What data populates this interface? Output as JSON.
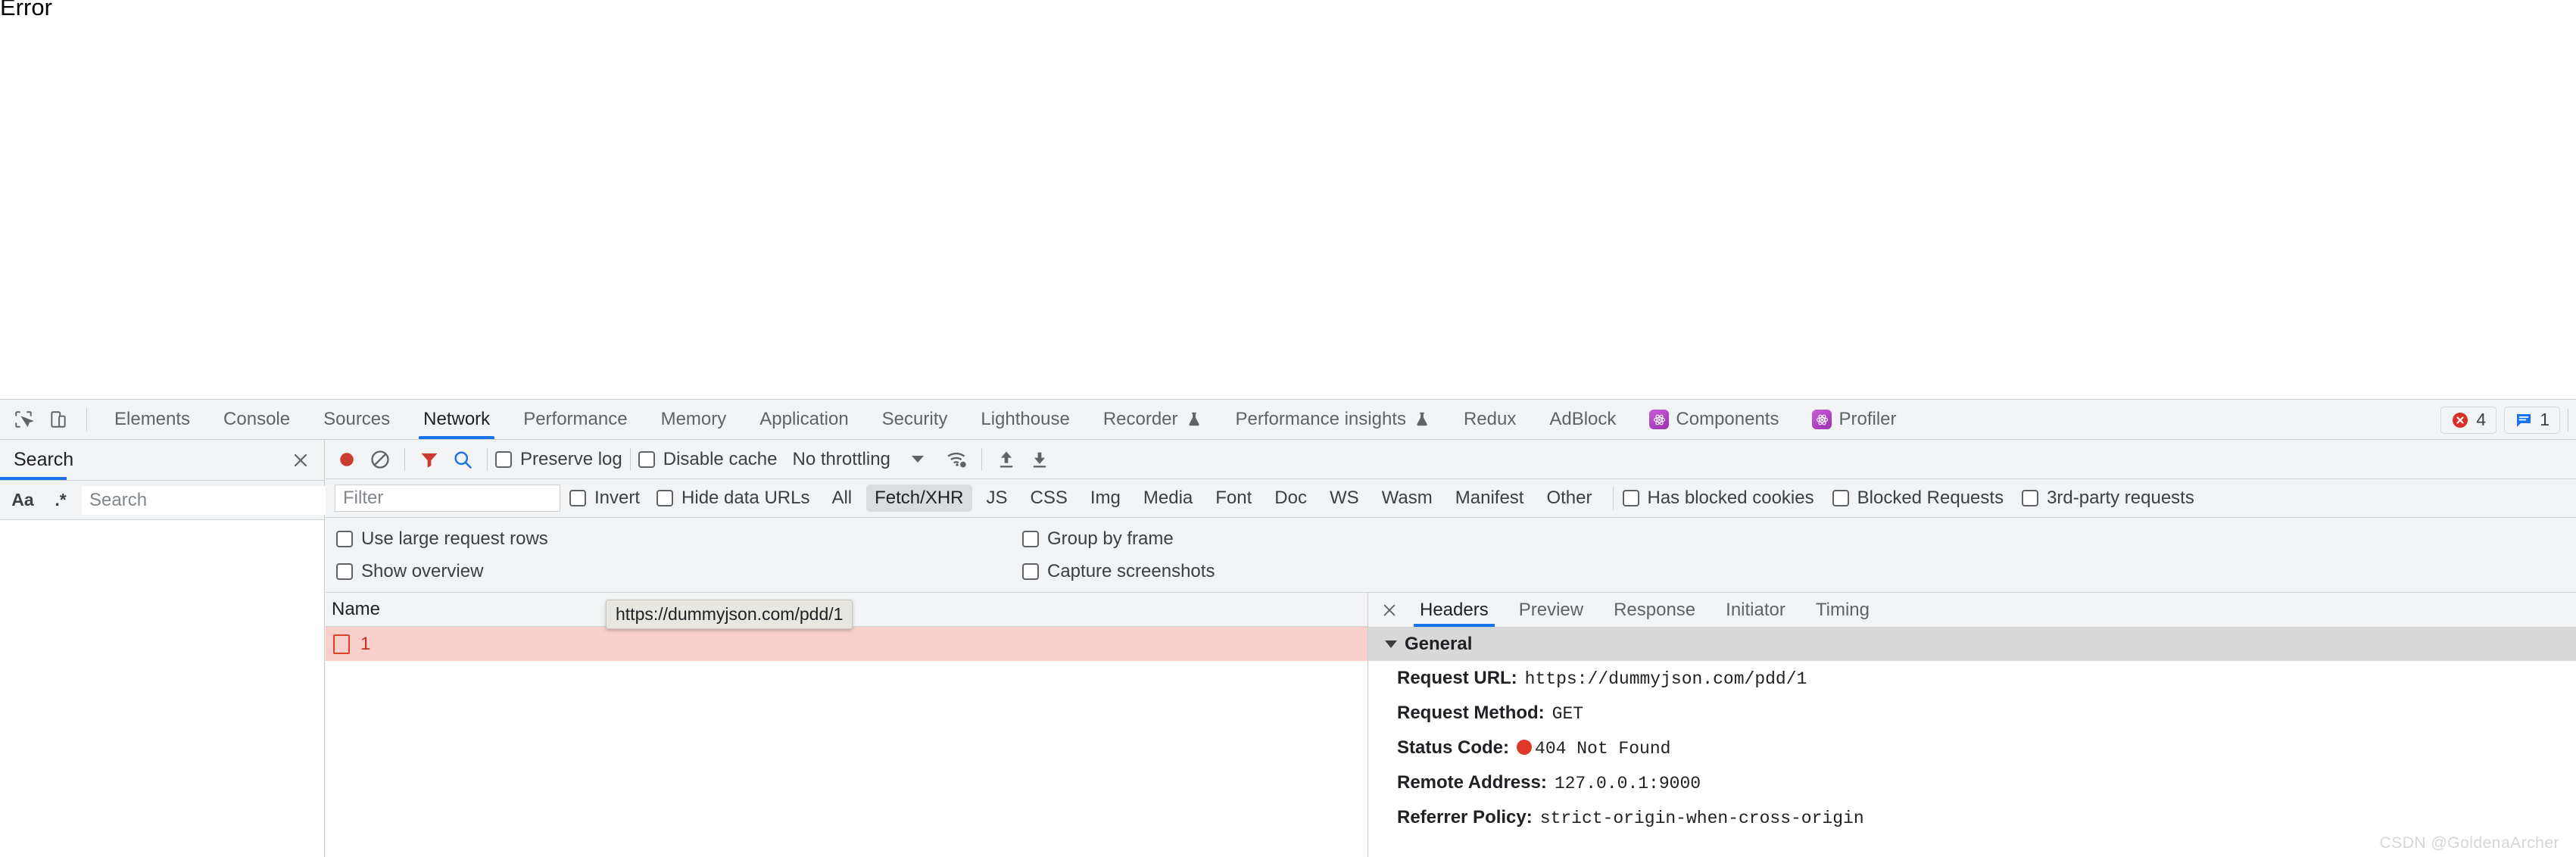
{
  "page": {
    "error_text": "Error"
  },
  "devtools": {
    "inspect_icon": "inspect-element-icon",
    "device_icon": "device-toolbar-icon",
    "tabs": [
      {
        "label": "Elements",
        "active": false,
        "flask": false,
        "ext": false
      },
      {
        "label": "Console",
        "active": false,
        "flask": false,
        "ext": false
      },
      {
        "label": "Sources",
        "active": false,
        "flask": false,
        "ext": false
      },
      {
        "label": "Network",
        "active": true,
        "flask": false,
        "ext": false
      },
      {
        "label": "Performance",
        "active": false,
        "flask": false,
        "ext": false
      },
      {
        "label": "Memory",
        "active": false,
        "flask": false,
        "ext": false
      },
      {
        "label": "Application",
        "active": false,
        "flask": false,
        "ext": false
      },
      {
        "label": "Security",
        "active": false,
        "flask": false,
        "ext": false
      },
      {
        "label": "Lighthouse",
        "active": false,
        "flask": false,
        "ext": false
      },
      {
        "label": "Recorder",
        "active": false,
        "flask": true,
        "ext": false
      },
      {
        "label": "Performance insights",
        "active": false,
        "flask": true,
        "ext": false
      },
      {
        "label": "Redux",
        "active": false,
        "flask": false,
        "ext": false
      },
      {
        "label": "AdBlock",
        "active": false,
        "flask": false,
        "ext": false
      },
      {
        "label": "Components",
        "active": false,
        "flask": false,
        "ext": true
      },
      {
        "label": "Profiler",
        "active": false,
        "flask": false,
        "ext": true
      }
    ],
    "error_count": "4",
    "message_count": "1",
    "error_icon": "error-circle-icon",
    "message_icon": "message-bubble-icon"
  },
  "search_drawer": {
    "title": "Search",
    "close_icon": "close-icon",
    "match_case_label": "Aa",
    "regex_label": ".*",
    "input_value": "",
    "input_placeholder": "Search",
    "refresh_icon": "refresh-icon",
    "clear_icon": "clear-icon"
  },
  "network": {
    "toolbar": {
      "record_icon": "record-button-icon",
      "clear_icon": "clear-icon",
      "filter_icon": "filter-icon",
      "search_icon": "search-icon",
      "preserve_log_label": "Preserve log",
      "preserve_log_checked": false,
      "disable_cache_label": "Disable cache",
      "disable_cache_checked": false,
      "throttling_value": "No throttling",
      "network_conditions_icon": "wifi-settings-icon",
      "import_icon": "import-har-icon",
      "export_icon": "export-har-icon"
    },
    "filterbar": {
      "filter_value": "",
      "filter_placeholder": "Filter",
      "invert_label": "Invert",
      "invert_checked": false,
      "hide_data_urls_label": "Hide data URLs",
      "hide_data_urls_checked": false,
      "types": [
        {
          "label": "All",
          "selected": false
        },
        {
          "label": "Fetch/XHR",
          "selected": true
        },
        {
          "label": "JS",
          "selected": false
        },
        {
          "label": "CSS",
          "selected": false
        },
        {
          "label": "Img",
          "selected": false
        },
        {
          "label": "Media",
          "selected": false
        },
        {
          "label": "Font",
          "selected": false
        },
        {
          "label": "Doc",
          "selected": false
        },
        {
          "label": "WS",
          "selected": false
        },
        {
          "label": "Wasm",
          "selected": false
        },
        {
          "label": "Manifest",
          "selected": false
        },
        {
          "label": "Other",
          "selected": false
        }
      ],
      "has_blocked_cookies_label": "Has blocked cookies",
      "has_blocked_cookies_checked": false,
      "blocked_requests_label": "Blocked Requests",
      "blocked_requests_checked": false,
      "third_party_label": "3rd-party requests",
      "third_party_checked": false
    },
    "settings": {
      "use_large_rows_label": "Use large request rows",
      "use_large_rows_checked": false,
      "show_overview_label": "Show overview",
      "show_overview_checked": false,
      "group_by_frame_label": "Group by frame",
      "group_by_frame_checked": false,
      "capture_screenshots_label": "Capture screenshots",
      "capture_screenshots_checked": false
    },
    "table": {
      "columns": [
        "Name"
      ],
      "rows": [
        {
          "name": "1",
          "status": "error",
          "icon": "document-error-icon"
        }
      ],
      "tooltip": "https://dummyjson.com/pdd/1"
    }
  },
  "detail": {
    "close_icon": "close-icon",
    "tabs": [
      {
        "label": "Headers",
        "active": true
      },
      {
        "label": "Preview",
        "active": false
      },
      {
        "label": "Response",
        "active": false
      },
      {
        "label": "Initiator",
        "active": false
      },
      {
        "label": "Timing",
        "active": false
      }
    ],
    "general": {
      "section_title": "General",
      "expanded": true,
      "rows": [
        {
          "key": "Request URL:",
          "value": "https://dummyjson.com/pdd/1",
          "status_dot": false
        },
        {
          "key": "Request Method:",
          "value": "GET",
          "status_dot": false
        },
        {
          "key": "Status Code:",
          "value": "404 Not Found",
          "status_dot": true
        },
        {
          "key": "Remote Address:",
          "value": "127.0.0.1:9000",
          "status_dot": false
        },
        {
          "key": "Referrer Policy:",
          "value": "strict-origin-when-cross-origin",
          "status_dot": false
        }
      ]
    }
  },
  "watermark": "CSDN @GoldenaArcher",
  "colors": {
    "accent": "#1a73e8",
    "error_red": "#e0392b",
    "row_bg": "#f8cfcb",
    "toolbar_bg": "#f1f3f4"
  }
}
